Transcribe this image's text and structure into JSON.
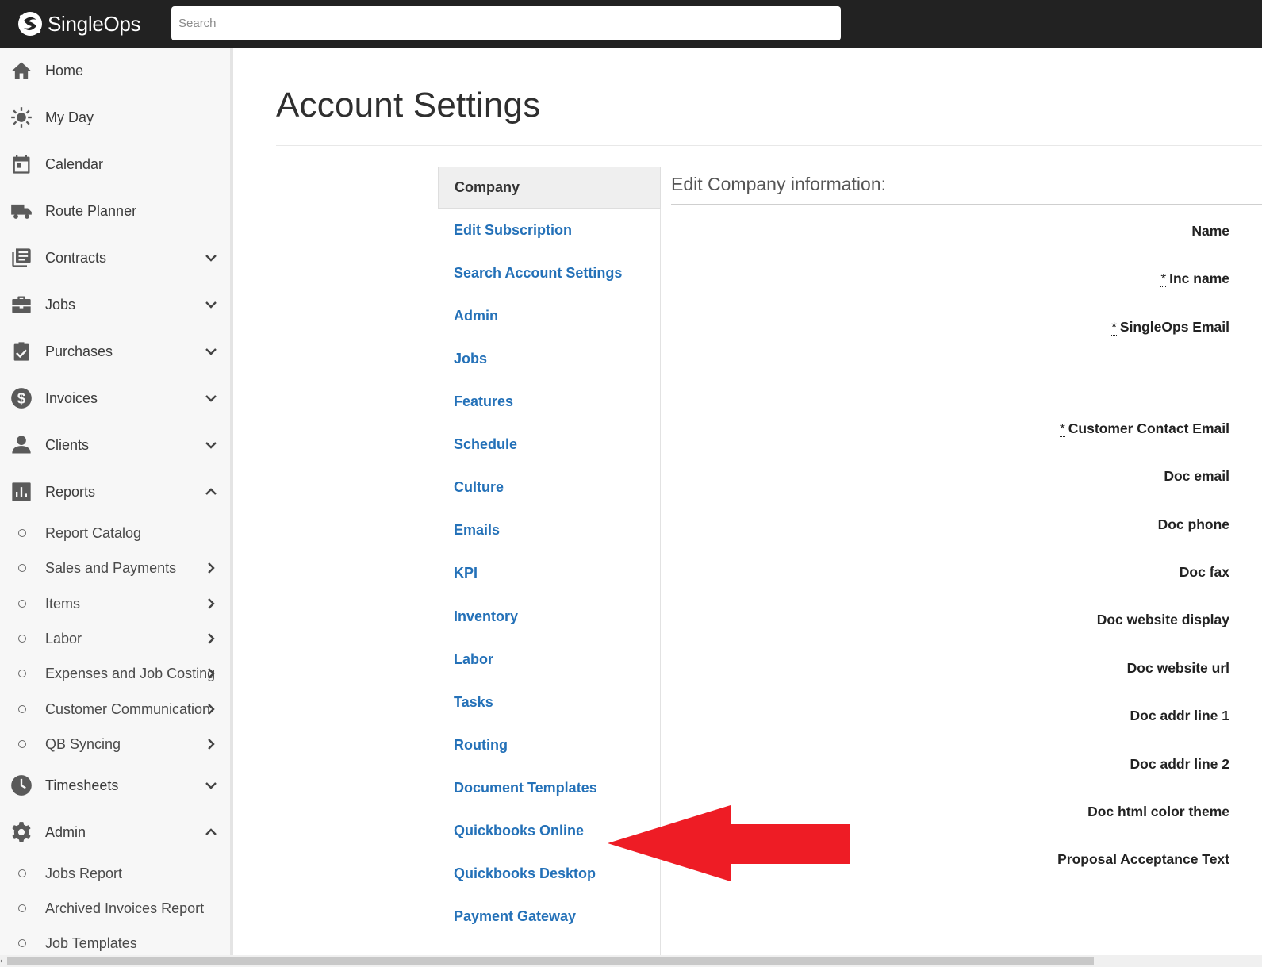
{
  "app": {
    "name": "SingleOps"
  },
  "search": {
    "placeholder": "Search"
  },
  "sidebar": {
    "items": [
      {
        "label": "Home",
        "icon": "home-icon"
      },
      {
        "label": "My Day",
        "icon": "sun-icon"
      },
      {
        "label": "Calendar",
        "icon": "calendar-icon"
      },
      {
        "label": "Route Planner",
        "icon": "truck-icon"
      },
      {
        "label": "Contracts",
        "icon": "contracts-icon",
        "chevron": "down"
      },
      {
        "label": "Jobs",
        "icon": "briefcase-icon",
        "chevron": "down"
      },
      {
        "label": "Purchases",
        "icon": "clipboard-check-icon",
        "chevron": "down"
      },
      {
        "label": "Invoices",
        "icon": "dollar-icon",
        "chevron": "down"
      },
      {
        "label": "Clients",
        "icon": "person-icon",
        "chevron": "down"
      },
      {
        "label": "Reports",
        "icon": "bar-chart-icon",
        "chevron": "up"
      }
    ],
    "reports_sub": [
      {
        "label": "Report Catalog"
      },
      {
        "label": "Sales and Payments",
        "chevron": "right"
      },
      {
        "label": "Items",
        "chevron": "right"
      },
      {
        "label": "Labor",
        "chevron": "right"
      },
      {
        "label": "Expenses and Job Costing",
        "chevron": "right"
      },
      {
        "label": "Customer Communication",
        "chevron": "right"
      },
      {
        "label": "QB Syncing",
        "chevron": "right"
      }
    ],
    "items2": [
      {
        "label": "Timesheets",
        "icon": "clock-icon",
        "chevron": "down"
      },
      {
        "label": "Admin",
        "icon": "gear-icon",
        "chevron": "up"
      }
    ],
    "admin_sub": [
      {
        "label": "Jobs Report"
      },
      {
        "label": "Archived Invoices Report"
      },
      {
        "label": "Job Templates"
      }
    ]
  },
  "main": {
    "title": "Account Settings",
    "settings_nav": {
      "active": "Company",
      "links": [
        "Edit Subscription",
        "Search Account Settings",
        "Admin",
        "Jobs",
        "Features",
        "Schedule",
        "Culture",
        "Emails",
        "KPI",
        "Inventory",
        "Labor",
        "Tasks",
        "Routing",
        "Document Templates",
        "Quickbooks Online",
        "Quickbooks Desktop",
        "Payment Gateway"
      ]
    },
    "form": {
      "heading": "Edit Company information:",
      "required_mark": "*",
      "fields": [
        {
          "label": "Name",
          "required": false
        },
        {
          "label": "Inc name",
          "required": true
        },
        {
          "label": "SingleOps Email",
          "required": true
        },
        {
          "label": "Customer Contact Email",
          "required": true
        },
        {
          "label": "Doc email",
          "required": false
        },
        {
          "label": "Doc phone",
          "required": false
        },
        {
          "label": "Doc fax",
          "required": false
        },
        {
          "label": "Doc website display",
          "required": false
        },
        {
          "label": "Doc website url",
          "required": false
        },
        {
          "label": "Doc addr line 1",
          "required": false
        },
        {
          "label": "Doc addr line 2",
          "required": false
        },
        {
          "label": "Doc html color theme",
          "required": false
        },
        {
          "label": "Proposal Acceptance Text",
          "required": false
        }
      ]
    }
  },
  "annotation": {
    "arrow_color": "#ee1c25"
  },
  "colors": {
    "topbar": "#222222",
    "link": "#2471b8",
    "sidebar_bg": "#f7f7f7"
  }
}
